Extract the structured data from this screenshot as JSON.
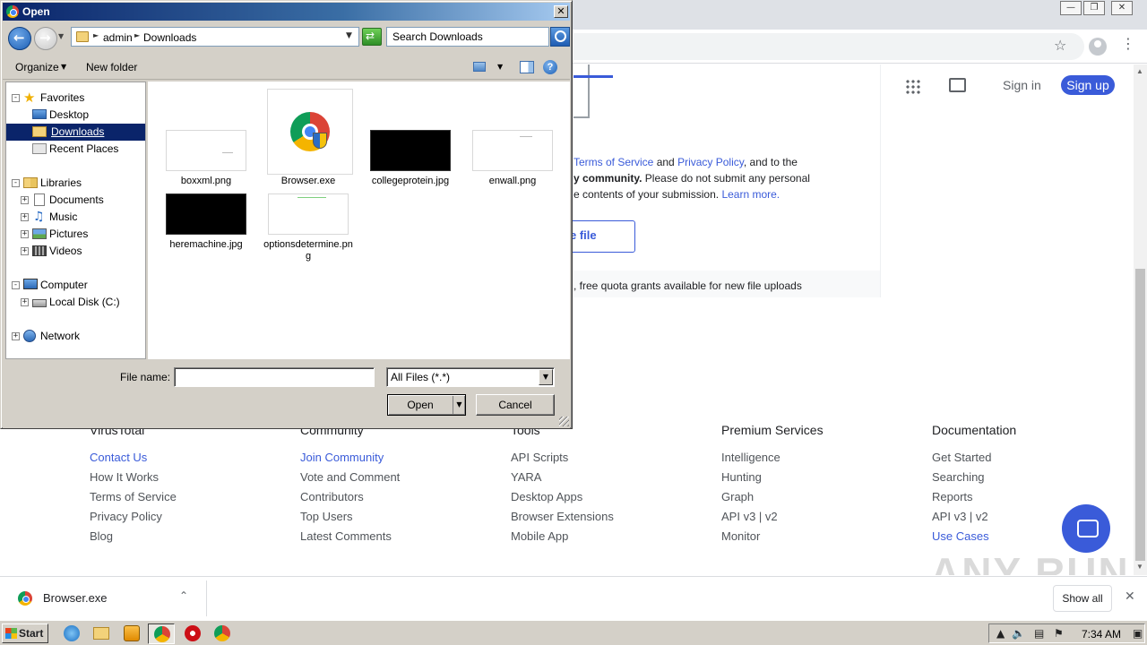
{
  "browser": {
    "header": {
      "sign_in": "Sign in",
      "sign_up": "Sign up"
    },
    "tos": {
      "line1_links": [
        "Terms of Service",
        "Privacy Policy"
      ],
      "line1_and": "and",
      "line1_tail": ", and to the",
      "line2_bold": "y community.",
      "line2_rest": " Please do not submit any personal",
      "line3_text": "e contents of your submission.",
      "line3_link": "Learn more."
    },
    "choose_file_label": "e file",
    "quota_text": ", free quota grants available for new file uploads",
    "footer": {
      "columns": [
        {
          "head": "VirusTotal",
          "items": [
            "Contact Us",
            "How It Works",
            "Terms of Service",
            "Privacy Policy",
            "Blog"
          ]
        },
        {
          "head": "Community",
          "items": [
            "Join Community",
            "Vote and Comment",
            "Contributors",
            "Top Users",
            "Latest Comments"
          ]
        },
        {
          "head": "Tools",
          "items": [
            "API Scripts",
            "YARA",
            "Desktop Apps",
            "Browser Extensions",
            "Mobile App"
          ]
        },
        {
          "head": "Premium Services",
          "items": [
            "Intelligence",
            "Hunting",
            "Graph",
            "API v3 | v2",
            "Monitor"
          ]
        },
        {
          "head": "Documentation",
          "items": [
            "Get Started",
            "Searching",
            "Reports",
            "API v3 | v2",
            "Use Cases"
          ]
        }
      ]
    },
    "watermark": "ANY RUN",
    "download_shelf": {
      "file": "Browser.exe",
      "show_all": "Show all"
    }
  },
  "dialog": {
    "title": "Open",
    "close_glyph": "✕",
    "breadcrumbs": [
      "admin",
      "Downloads"
    ],
    "search_placeholder": "Search Downloads",
    "toolbar": {
      "organize": "Organize",
      "new_folder": "New folder",
      "help": "?"
    },
    "tree": [
      {
        "label": "Favorites",
        "icon": "star-icon"
      },
      {
        "label": "Desktop",
        "icon": "desktop-icon"
      },
      {
        "label": "Downloads",
        "icon": "folder-icon",
        "selected": true
      },
      {
        "label": "Recent Places",
        "icon": "recent-places-icon"
      },
      {
        "label": "Libraries",
        "icon": "libraries-icon"
      },
      {
        "label": "Documents",
        "icon": "documents-icon"
      },
      {
        "label": "Music",
        "icon": "music-icon"
      },
      {
        "label": "Pictures",
        "icon": "pictures-icon"
      },
      {
        "label": "Videos",
        "icon": "videos-icon"
      },
      {
        "label": "Computer",
        "icon": "computer-icon"
      },
      {
        "label": "Local Disk (C:)",
        "icon": "disk-icon"
      },
      {
        "label": "Network",
        "icon": "network-icon"
      }
    ],
    "files": [
      {
        "name": "boxxml.png",
        "thumb": "white"
      },
      {
        "name": "Browser.exe",
        "thumb": "app"
      },
      {
        "name": "collegeprotein.jpg",
        "thumb": "black"
      },
      {
        "name": "enwall.png",
        "thumb": "white"
      },
      {
        "name": "heremachine.jpg",
        "thumb": "black"
      },
      {
        "name": "optionsdetermine.png",
        "thumb": "white"
      }
    ],
    "file_name_label": "File name:",
    "file_name_value": "",
    "file_type": "All Files (*.*)",
    "open_label": "Open",
    "cancel_label": "Cancel"
  },
  "taskbar": {
    "start": "Start",
    "clock": "7:34 AM"
  }
}
